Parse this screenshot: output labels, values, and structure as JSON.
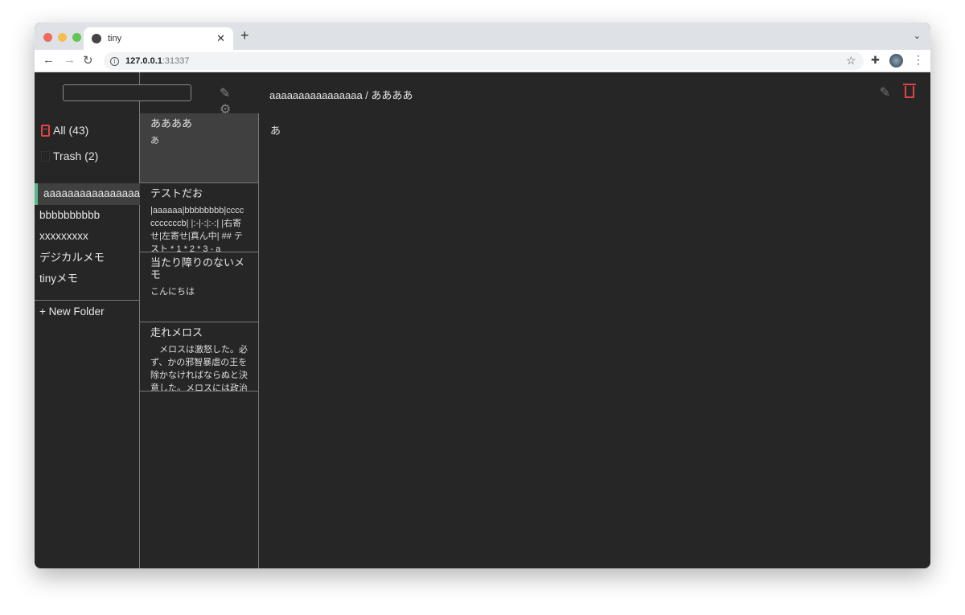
{
  "browser": {
    "tab_title": "tiny",
    "url_host": "127.0.0.1",
    "url_port": ":31337",
    "colors": {
      "close": "#ed6a5e",
      "minimize": "#f5bf4f",
      "maximize": "#62c554"
    }
  },
  "sidebar": {
    "search_placeholder": "",
    "all_label": "All (43)",
    "trash_label": "Trash (2)",
    "folders": [
      "aaaaaaaaaaaaaaaa",
      "bbbbbbbbbb",
      "xxxxxxxxx",
      "デジカルメモ",
      "tinyメモ"
    ],
    "new_folder_label": "+ New Folder",
    "accent": "#5bb88a"
  },
  "notes": [
    {
      "title": "ああああ",
      "body": "あ"
    },
    {
      "title": "テストだお",
      "body": "|aaaaaa|bbbbbbbb|cccccccccccb| |:-|-:|:-:| |右寄せ|左寄せ|真ん中| ## テスト * 1 * 2 * 3 - a"
    },
    {
      "title": "当たり障りのないメモ",
      "body": "こんにちは"
    },
    {
      "title": "走れメロス",
      "body": "　メロスは激怒した。必ず、かの邪智暴虐の王を除かなければならぬと決意した。メロスには政治"
    }
  ],
  "main": {
    "breadcrumb": "aaaaaaaaaaaaaaaa / ああああ",
    "content": "あ",
    "delete_color": "#e04545"
  }
}
